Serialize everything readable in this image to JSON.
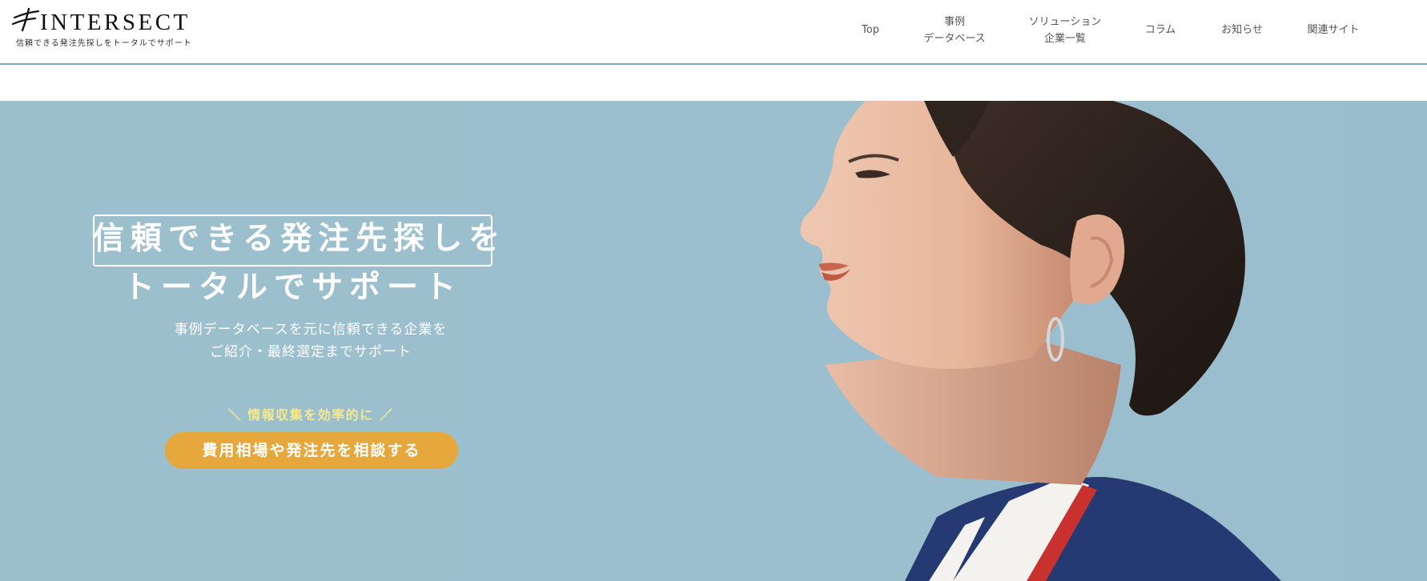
{
  "header": {
    "logo": {
      "wordmark": "INTERSECT",
      "tagline": "信頼できる発注先探しをトータルでサポート",
      "mark_icon": "intersect-logo-mark-icon"
    },
    "nav": [
      {
        "line1": "Top",
        "line2": ""
      },
      {
        "line1": "事例",
        "line2": "データベース"
      },
      {
        "line1": "ソリューション",
        "line2": "企業一覧"
      },
      {
        "line1": "コラム",
        "line2": ""
      },
      {
        "line1": "お知らせ",
        "line2": ""
      },
      {
        "line1": "関連サイト",
        "line2": ""
      }
    ],
    "border_color": "#7fa8b9"
  },
  "hero": {
    "headline_line1": "信頼できる発注先探しを",
    "headline_line2": "トータルでサポート",
    "sub_line1": "事例データベースを元に信頼できる企業を",
    "sub_line2": "ご紹介・最終選定までサポート",
    "cta_caption": "＼ 情報収集を効率的に ／",
    "cta_button": "費用相場や発注先を相談する",
    "background_color": "#9cbfce",
    "cta_color": "#e6a83c",
    "caption_color": "#f5e98f",
    "image": "woman-profile-photo"
  }
}
